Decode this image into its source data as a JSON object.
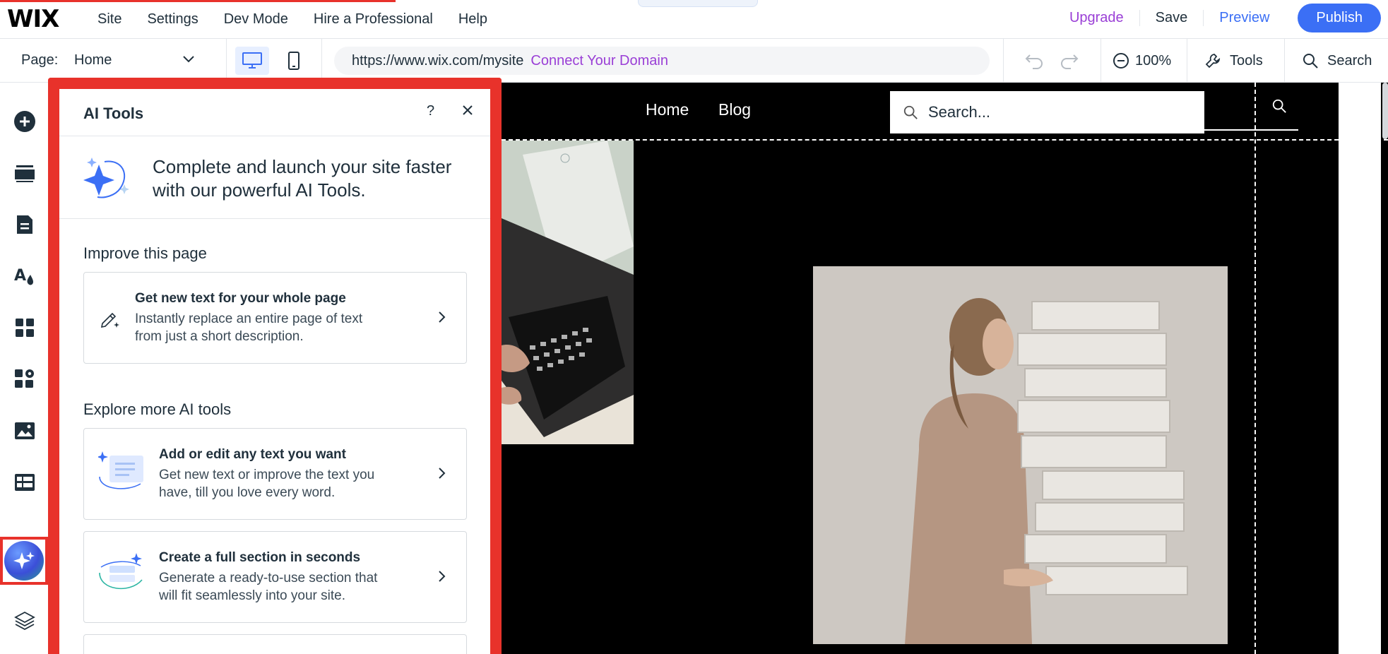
{
  "topbar": {
    "logo": "WIX",
    "menu": [
      "Site",
      "Settings",
      "Dev Mode",
      "Hire a Professional",
      "Help"
    ],
    "upgrade": "Upgrade",
    "save": "Save",
    "preview": "Preview",
    "publish": "Publish"
  },
  "toolbar": {
    "page_label": "Page:",
    "page_value": "Home",
    "url": "https://www.wix.com/mysite",
    "connect_domain": "Connect Your Domain",
    "zoom": "100%",
    "tools": "Tools",
    "search": "Search"
  },
  "site": {
    "nav": [
      "Home",
      "Blog"
    ],
    "search_placeholder": "Search..."
  },
  "ai_panel": {
    "title": "AI Tools",
    "help": "?",
    "promo": "Complete and launch your site faster with our powerful AI Tools.",
    "section_improve": "Improve this page",
    "section_explore": "Explore more AI tools",
    "cards": [
      {
        "title": "Get new text for your whole page",
        "desc_line1": "Instantly replace an entire page of text",
        "desc_line2": "from just a short description."
      },
      {
        "title": "Add or edit any text you want",
        "desc_line1": "Get new text or improve the text you",
        "desc_line2": "have, till you love every word."
      },
      {
        "title": "Create a full section in seconds",
        "desc_line1": "Generate a ready-to-use section that",
        "desc_line2": "will fit seamlessly into your site."
      }
    ]
  },
  "colors": {
    "accent_blue": "#3b6ff5",
    "upgrade_purple": "#9a3fd6",
    "highlight_red": "#e8322b"
  }
}
